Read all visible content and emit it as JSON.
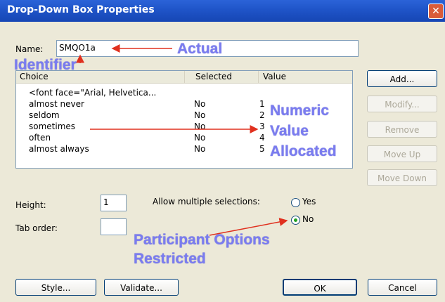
{
  "window": {
    "title": "Drop-Down Box Properties",
    "close_icon": "close-icon"
  },
  "name_field": {
    "label": "Name:",
    "value": "SMQO1a"
  },
  "list": {
    "headers": [
      "Choice",
      "Selected",
      "Value"
    ],
    "rows": [
      {
        "choice": "<font face=\"Arial, Helvetica...",
        "selected": "",
        "value": ""
      },
      {
        "choice": "almost never",
        "selected": "No",
        "value": "1"
      },
      {
        "choice": "seldom",
        "selected": "No",
        "value": "2"
      },
      {
        "choice": "sometimes",
        "selected": "No",
        "value": "3"
      },
      {
        "choice": "often",
        "selected": "No",
        "value": "4"
      },
      {
        "choice": "almost always",
        "selected": "No",
        "value": "5"
      }
    ]
  },
  "side_buttons": {
    "add": "Add...",
    "modify": "Modify...",
    "remove": "Remove",
    "move_up": "Move Up",
    "move_down": "Move Down"
  },
  "height": {
    "label": "Height:",
    "value": "1"
  },
  "tab_order": {
    "label": "Tab order:",
    "value": ""
  },
  "multiple": {
    "label": "Allow multiple selections:",
    "yes": "Yes",
    "no": "No",
    "selected": "No"
  },
  "bottom_buttons": {
    "style": "Style...",
    "validate": "Validate...",
    "ok": "OK",
    "cancel": "Cancel"
  },
  "annotations": {
    "actual": "Actual",
    "identifier": "Identifier",
    "numeric": "Numeric",
    "value": "Value",
    "allocated": "Allocated",
    "participant": "Participant Options",
    "restricted": "Restricted"
  },
  "colors": {
    "annotation": "#7a7cf0",
    "arrow": "#e0301e",
    "titlebar": "#1f54c8"
  }
}
